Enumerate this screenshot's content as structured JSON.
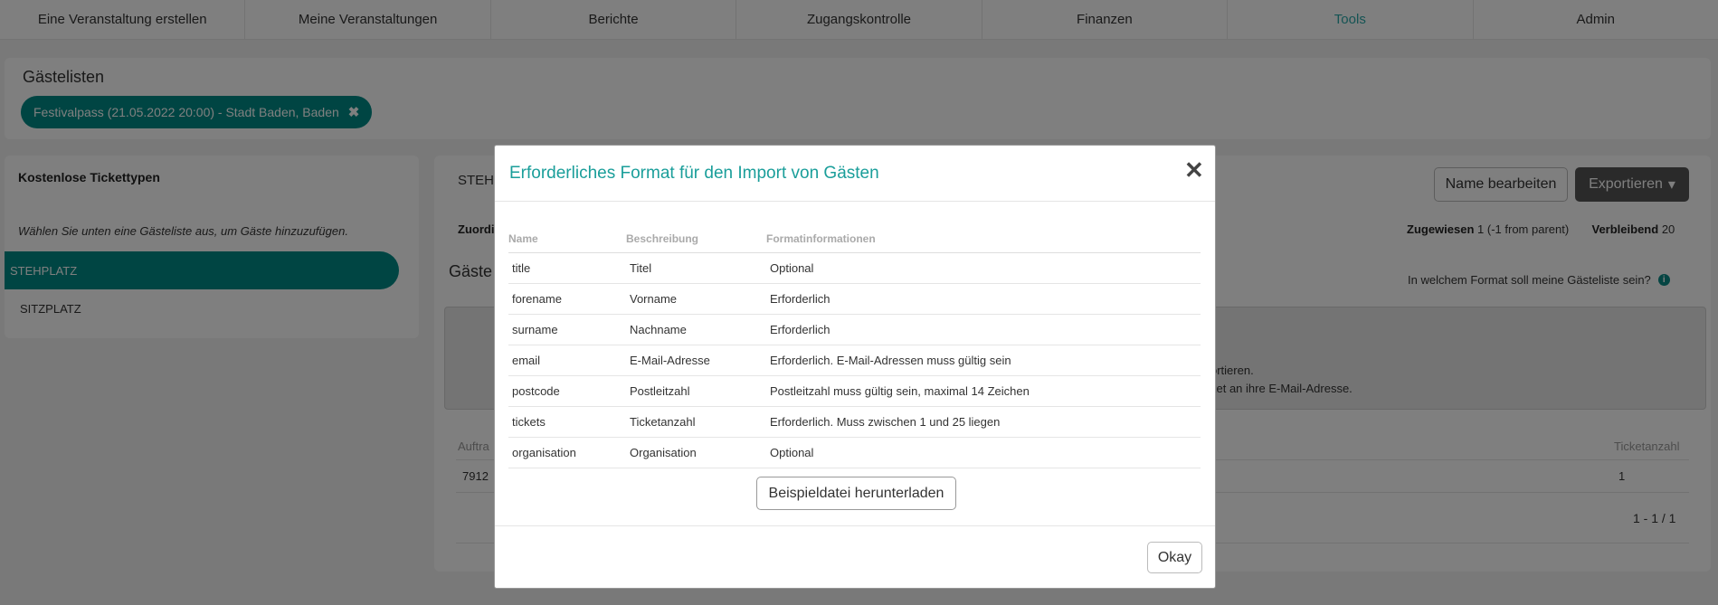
{
  "nav": {
    "items": [
      "Eine Veranstaltung erstellen",
      "Meine Veranstaltungen",
      "Berichte",
      "Zugangskontrolle",
      "Finanzen",
      "Tools",
      "Admin"
    ],
    "active": "Tools"
  },
  "guestlists": {
    "title": "Gästelisten",
    "chip_label": "Festivalpass (21.05.2022 20:00) - Stadt Baden, Baden"
  },
  "sidebar": {
    "title": "Kostenlose Tickettypen",
    "hint": "Wählen Sie unten eine Gästeliste aus, um Gäste hinzuzufügen.",
    "items": [
      "STEHPLATZ",
      "SITZPLATZ"
    ]
  },
  "main": {
    "heading_partial": "STEHF",
    "name_button": "Name bearbeiten",
    "export_button": "Exportieren",
    "zuord_partial": "Zuordi",
    "zugewiesen_label": "Zugewiesen",
    "zugewiesen_value": "1 (-1 from parent)",
    "verbleibend_label": "Verbleibend",
    "verbleibend_value": "20",
    "gaeste_partial": "Gäste",
    "format_question": "In welchem Format soll meine Gästeliste sein?",
    "drop_line1": "ortieren.",
    "drop_line2": "ket an ihre E-Mail-Adresse.",
    "col_auftrag_partial": "Auftra",
    "col_ticketanzahl": "Ticketanzahl",
    "row_id_partial": "7912",
    "row_tickets": "1",
    "pagination": "1 - 1 / 1"
  },
  "modal": {
    "title": "Erforderliches Format für den Import von Gästen",
    "close_symbol": "✕",
    "headers": [
      "Name",
      "Beschreibung",
      "Formatinformationen"
    ],
    "rows": [
      [
        "title",
        "Titel",
        "Optional"
      ],
      [
        "forename",
        "Vorname",
        "Erforderlich"
      ],
      [
        "surname",
        "Nachname",
        "Erforderlich"
      ],
      [
        "email",
        "E-Mail-Adresse",
        "Erforderlich. E-Mail-Adressen muss gültig sein"
      ],
      [
        "postcode",
        "Postleitzahl",
        "Postleitzahl muss gültig sein, maximal 14 Zeichen"
      ],
      [
        "tickets",
        "Ticketanzahl",
        "Erforderlich. Muss zwischen 1 und 25 liegen"
      ],
      [
        "organisation",
        "Organisation",
        "Optional"
      ]
    ],
    "download_button": "Beispieldatei herunterladen",
    "okay_button": "Okay"
  },
  "colors": {
    "accent": "#008b86",
    "title_accent": "#1a9e9a",
    "nav_active": "#2aa8a8"
  }
}
